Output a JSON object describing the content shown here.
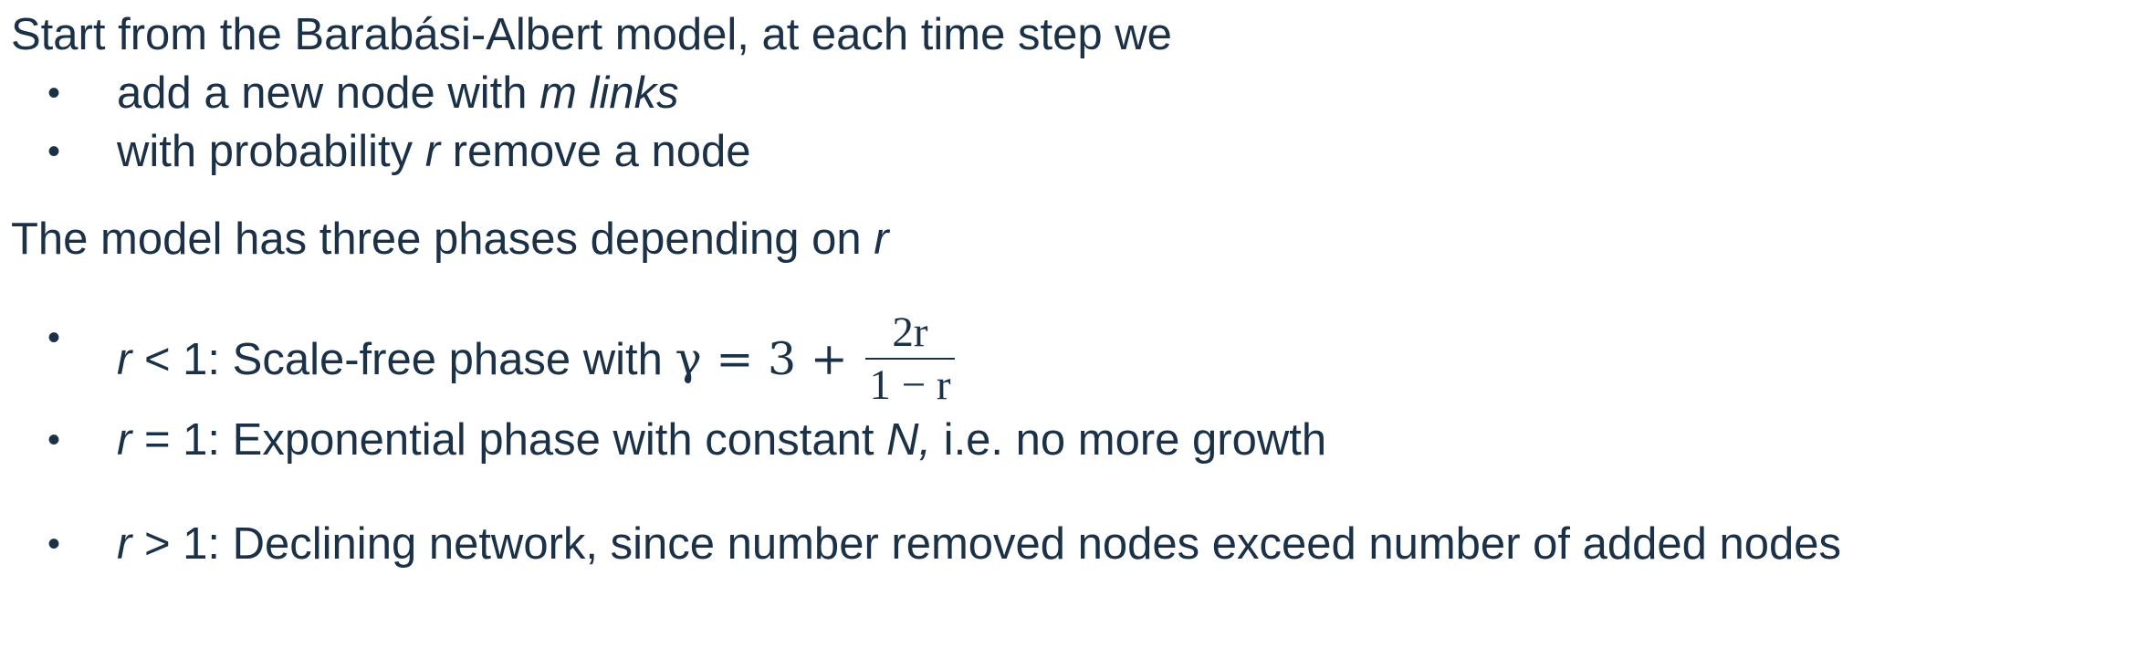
{
  "intro": {
    "text": "Start from the Barabási-Albert model, at each time step we"
  },
  "steps": [
    {
      "pre": "add a new node with ",
      "em": "m links",
      "post": ""
    },
    {
      "pre": "with probability ",
      "em": "r",
      "post": " remove a node"
    }
  ],
  "phases_heading": {
    "text": "The model has three phases depending on ",
    "em": "r"
  },
  "phases": [
    {
      "var": "r",
      "rest": " < 1: Scale-free phase with ",
      "formula": {
        "lhs": "γ = 3 + ",
        "numerator": "2r",
        "denominator": "1 − r"
      }
    },
    {
      "var": "r",
      "rest": " = 1: Exponential phase with constant ",
      "em": "N,",
      "post": " i.e. no more growth"
    },
    {
      "var": "r",
      "rest": " > 1: Declining network, since number removed nodes exceed number of added nodes"
    }
  ],
  "bullet_glyph": "•"
}
